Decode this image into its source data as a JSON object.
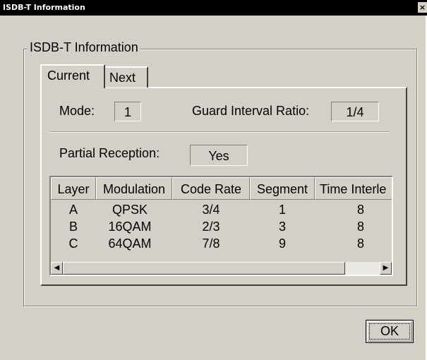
{
  "window": {
    "title": "ISDB-T Information",
    "close_glyph": "×"
  },
  "group": {
    "label": "ISDB-T Information"
  },
  "tabs": [
    {
      "label": "Current"
    },
    {
      "label": "Next"
    }
  ],
  "info": {
    "mode_label": "Mode:",
    "mode_value": "1",
    "guard_label": "Guard Interval Ratio:",
    "guard_value": "1/4",
    "partial_label": "Partial Reception:",
    "partial_value": "Yes"
  },
  "table": {
    "headers": [
      "Layer",
      "Modulation",
      "Code Rate",
      "Segment",
      "Time Interle"
    ],
    "rows": [
      [
        "A",
        "QPSK",
        "3/4",
        "1",
        "8"
      ],
      [
        "B",
        "16QAM",
        "2/3",
        "3",
        "8"
      ],
      [
        "C",
        "64QAM",
        "7/8",
        "9",
        "8"
      ]
    ],
    "scroll_left_glyph": "◀",
    "scroll_right_glyph": "▶"
  },
  "buttons": {
    "ok_label": "OK"
  }
}
